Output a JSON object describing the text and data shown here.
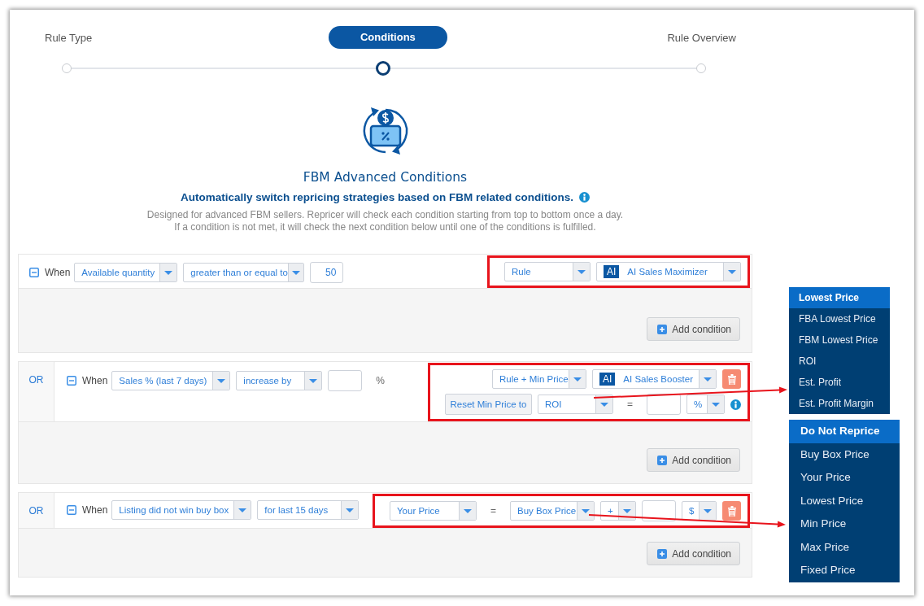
{
  "steps": [
    {
      "label": "Rule Type",
      "selected": false
    },
    {
      "label": "Conditions",
      "selected": true
    },
    {
      "label": "Rule Overview",
      "selected": false
    }
  ],
  "header": {
    "title": "FBM Advanced Conditions",
    "subtitle": "Automatically switch repricing strategies based on FBM related conditions.",
    "description": [
      "Designed for advanced FBM sellers. Repricer will check each condition starting from top to bottom once a day.",
      "If a condition is not met, it will check the next condition below until one of the conditions is fulfilled."
    ]
  },
  "conditions": [
    {
      "when": "When",
      "fields": [
        {
          "kind": "select",
          "value": "Available quantity"
        },
        {
          "kind": "select",
          "value": "greater than or equal to"
        },
        {
          "kind": "input",
          "value": "50"
        }
      ],
      "highlighted": true,
      "actions": [
        [
          {
            "kind": "select",
            "value": "Rule"
          },
          {
            "kind": "ai-select",
            "badge": "AI",
            "value": "AI Sales Maximizer"
          }
        ]
      ],
      "add_button": "Add condition"
    },
    {
      "or_label": "OR",
      "when": "When",
      "fields": [
        {
          "kind": "select",
          "value": "Sales % (last 7 days)"
        },
        {
          "kind": "select",
          "value": "increase by"
        },
        {
          "kind": "input"
        },
        {
          "kind": "text",
          "value": "%"
        }
      ],
      "highlighted": true,
      "actions": [
        [
          {
            "kind": "select",
            "value": "Rule + Min Price"
          },
          {
            "kind": "ai-select",
            "badge": "AI",
            "value": "AI Sales Booster"
          },
          {
            "kind": "delete"
          }
        ],
        [
          {
            "kind": "button",
            "value": "Reset Min Price to"
          },
          {
            "kind": "select",
            "value": "ROI"
          },
          {
            "kind": "text",
            "value": "="
          },
          {
            "kind": "input"
          },
          {
            "kind": "select",
            "value": "%"
          },
          {
            "kind": "info"
          }
        ]
      ],
      "add_button": "Add condition"
    },
    {
      "or_label": "OR",
      "when": "When",
      "fields": [
        {
          "kind": "select",
          "value": "Listing did not win buy box"
        },
        {
          "kind": "select",
          "value": "for last 15 days"
        }
      ],
      "highlighted": true,
      "actions": [
        [
          {
            "kind": "select",
            "value": "Your Price"
          },
          {
            "kind": "text",
            "value": "="
          },
          {
            "kind": "select",
            "value": "Buy Box Price"
          },
          {
            "kind": "select",
            "value": "+"
          },
          {
            "kind": "input"
          },
          {
            "kind": "select",
            "value": "$"
          },
          {
            "kind": "delete"
          }
        ]
      ],
      "add_button": "Add condition"
    }
  ],
  "menus": [
    {
      "pointer_arrow": true,
      "items": [
        {
          "label": "Lowest Price",
          "selected": true
        },
        {
          "label": "FBA Lowest Price",
          "selected": false
        },
        {
          "label": "FBM Lowest Price",
          "selected": false
        },
        {
          "label": "ROI",
          "selected": false
        },
        {
          "label": "Est. Profit",
          "selected": false
        },
        {
          "label": "Est. Profit Margin",
          "selected": false
        }
      ]
    },
    {
      "pointer_arrow": true,
      "items": [
        {
          "label": "Do Not Reprice",
          "selected": true
        },
        {
          "label": "Buy Box Price",
          "selected": false
        },
        {
          "label": "Your Price",
          "selected": false
        },
        {
          "label": "Lowest Price",
          "selected": false
        },
        {
          "label": "Min Price",
          "selected": false
        },
        {
          "label": "Max Price",
          "selected": false
        },
        {
          "label": "Fixed Price",
          "selected": false
        }
      ]
    }
  ]
}
